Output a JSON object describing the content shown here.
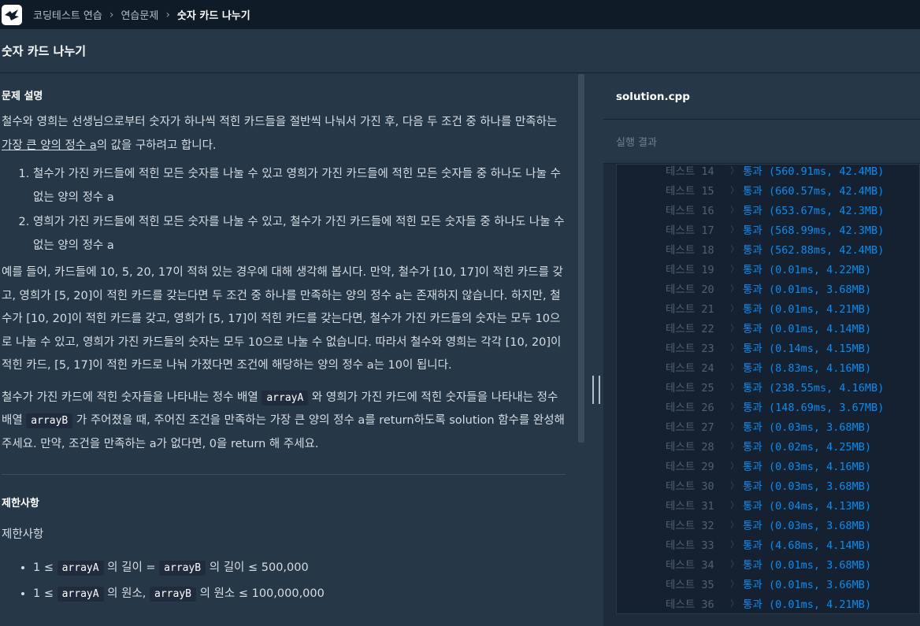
{
  "breadcrumb": {
    "items": [
      "코딩테스트 연습",
      "연습문제"
    ],
    "current": "숫자 카드 나누기"
  },
  "page_title": "숫자 카드 나누기",
  "problem": {
    "section_title": "문제 설명",
    "intro_before": "철수와 영희는 선생님으로부터 숫자가 하나씩 적힌 카드들을 절반씩 나눠서 가진 후, 다음 두 조건 중 하나를 만족하는 ",
    "intro_underline": "가장 큰 양의 정수 a",
    "intro_after": "의 값을 구하려고 합니다.",
    "conditions": [
      "철수가 가진 카드들에 적힌 모든 숫자를 나눌 수 있고 영희가 가진 카드들에 적힌 모든 숫자들 중 하나도 나눌 수 없는 양의 정수 a",
      "영희가 가진 카드들에 적힌 모든 숫자를 나눌 수 있고, 철수가 가진 카드들에 적힌 모든 숫자들 중 하나도 나눌 수 없는 양의 정수 a"
    ],
    "example": "예를 들어, 카드들에 10, 5, 20, 17이 적혀 있는 경우에 대해 생각해 봅시다. 만약, 철수가 [10, 17]이 적힌 카드를 갖고, 영희가 [5, 20]이 적힌 카드를 갖는다면 두 조건 중 하나를 만족하는 양의 정수 a는 존재하지 않습니다. 하지만, 철수가 [10, 20]이 적힌 카드를 갖고, 영희가 [5, 17]이 적힌 카드를 갖는다면, 철수가 가진 카드들의 숫자는 모두 10으로 나눌 수 있고, 영희가 가진 카드들의 숫자는 모두 10으로 나눌 수 없습니다. 따라서 철수와 영희는 각각 [10, 20]이 적힌 카드, [5, 17]이 적힌 카드로 나눠 가졌다면 조건에 해당하는 양의 정수 a는 10이 됩니다.",
    "task_part1": "철수가 가진 카드에 적힌 숫자들을 나타내는 정수 배열 ",
    "code_a": "arrayA",
    "task_part2": " 와 영희가 가진 카드에 적힌 숫자들을 나타내는 정수 배열 ",
    "code_b": "arrayB",
    "task_part3": " 가 주어졌을 때, 주어진 조건을 만족하는 가장 큰 양의 정수 a를 return하도록 solution 함수를 완성해 주세요. 만약, 조건을 만족하는 a가 없다면, 0을 return 해 주세요.",
    "limits_title": "제한사항",
    "limits_sub": "제한사항",
    "limit1": {
      "prefix": "1 ≤ ",
      "code_a": "arrayA",
      "mid": " 의 길이 = ",
      "code_b": "arrayB",
      "suffix": " 의 길이 ≤ 500,000"
    },
    "limit2": {
      "prefix": "1 ≤ ",
      "code_a": "arrayA",
      "mid": " 의 원소, ",
      "code_b": "arrayB",
      "suffix": " 의 원소 ≤ 100,000,000"
    }
  },
  "editor": {
    "file_tab": "solution.cpp",
    "result_title": "실행 결과"
  },
  "results": {
    "label": "테스트",
    "status": "통과",
    "rows": [
      {
        "n": "14",
        "time": "560.91ms",
        "mem": "42.4MB"
      },
      {
        "n": "15",
        "time": "660.57ms",
        "mem": "42.4MB"
      },
      {
        "n": "16",
        "time": "653.67ms",
        "mem": "42.3MB"
      },
      {
        "n": "17",
        "time": "568.99ms",
        "mem": "42.3MB"
      },
      {
        "n": "18",
        "time": "562.88ms",
        "mem": "42.4MB"
      },
      {
        "n": "19",
        "time": "0.01ms",
        "mem": "4.22MB"
      },
      {
        "n": "20",
        "time": "0.01ms",
        "mem": "3.68MB"
      },
      {
        "n": "21",
        "time": "0.01ms",
        "mem": "4.21MB"
      },
      {
        "n": "22",
        "time": "0.01ms",
        "mem": "4.14MB"
      },
      {
        "n": "23",
        "time": "0.14ms",
        "mem": "4.15MB"
      },
      {
        "n": "24",
        "time": "8.83ms",
        "mem": "4.16MB"
      },
      {
        "n": "25",
        "time": "238.55ms",
        "mem": "4.16MB"
      },
      {
        "n": "26",
        "time": "148.69ms",
        "mem": "3.67MB"
      },
      {
        "n": "27",
        "time": "0.03ms",
        "mem": "3.68MB"
      },
      {
        "n": "28",
        "time": "0.02ms",
        "mem": "4.25MB"
      },
      {
        "n": "29",
        "time": "0.03ms",
        "mem": "4.16MB"
      },
      {
        "n": "30",
        "time": "0.03ms",
        "mem": "3.68MB"
      },
      {
        "n": "31",
        "time": "0.04ms",
        "mem": "4.13MB"
      },
      {
        "n": "32",
        "time": "0.03ms",
        "mem": "3.68MB"
      },
      {
        "n": "33",
        "time": "4.68ms",
        "mem": "4.14MB"
      },
      {
        "n": "34",
        "time": "0.01ms",
        "mem": "3.68MB"
      },
      {
        "n": "35",
        "time": "0.01ms",
        "mem": "3.66MB"
      },
      {
        "n": "36",
        "time": "0.01ms",
        "mem": "4.21MB"
      }
    ]
  },
  "icons": {
    "logo": "programmers-logo-icon",
    "separator": "chevron-right-icon"
  },
  "colors": {
    "topbar": "#0f1b27",
    "panel": "#263747",
    "result_bg": "#152131",
    "pass": "#0b8cf0"
  }
}
